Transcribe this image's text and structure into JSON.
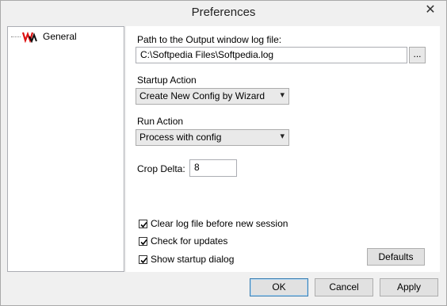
{
  "window": {
    "title": "Preferences",
    "close_glyph": "✕"
  },
  "tree": {
    "items": [
      {
        "label": "General",
        "icon": "app-logo-icon"
      }
    ]
  },
  "log": {
    "label": "Path to the Output window log file:",
    "value": "C:\\Softpedia Files\\Softpedia.log",
    "browse_label": "..."
  },
  "startup": {
    "label": "Startup Action",
    "selected": "Create New Config by Wizard"
  },
  "run": {
    "label": "Run Action",
    "selected": "Process with config"
  },
  "crop": {
    "label": "Crop Delta:",
    "value": "8"
  },
  "checks": [
    {
      "label": "Clear log file before new session",
      "checked": true
    },
    {
      "label": "Check for updates",
      "checked": true
    },
    {
      "label": "Show startup dialog",
      "checked": true
    }
  ],
  "buttons": {
    "defaults": "Defaults",
    "ok": "OK",
    "cancel": "Cancel",
    "apply": "Apply"
  },
  "colors": {
    "default_button_border": "#3c7fb1"
  }
}
